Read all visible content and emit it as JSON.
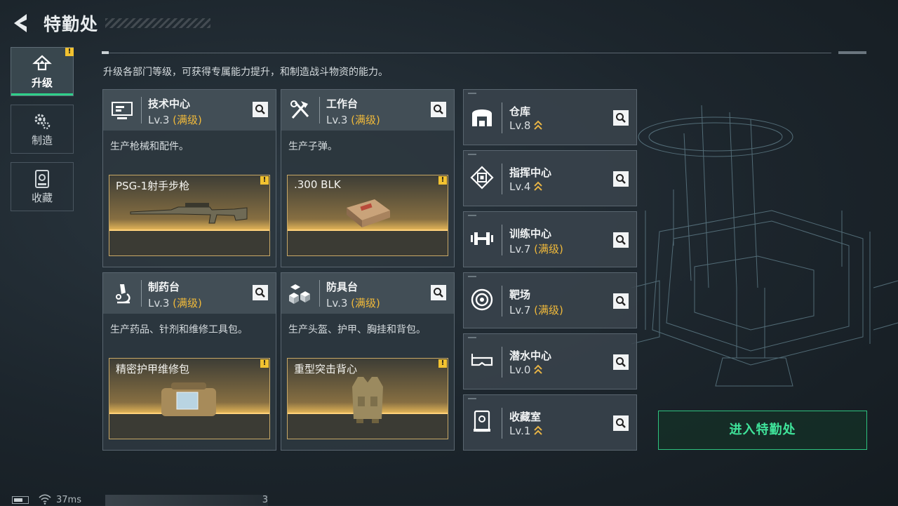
{
  "header": {
    "title": "特勤处"
  },
  "nav": [
    {
      "label": "升级",
      "active": true,
      "icon": "upgrade-icon"
    },
    {
      "label": "制造",
      "active": false,
      "icon": "gear-icon"
    },
    {
      "label": "收藏",
      "active": false,
      "icon": "collection-icon"
    }
  ],
  "description": "升级各部门等级，可获得专属能力提升，和制造战斗物资的能力。",
  "stations": [
    {
      "name": "技术中心",
      "level": "Lv.3",
      "max_label": "(满级)",
      "desc": "生产枪械和配件。",
      "product": "PSG-1射手步枪",
      "icon": "monitor-icon"
    },
    {
      "name": "工作台",
      "level": "Lv.3",
      "max_label": "(满级)",
      "desc": "生产子弹。",
      "product": ".300 BLK",
      "icon": "tools-icon"
    },
    {
      "name": "制药台",
      "level": "Lv.3",
      "max_label": "(满级)",
      "desc": "生产药品、针剂和维修工具包。",
      "product": "精密护甲维修包",
      "icon": "microscope-icon"
    },
    {
      "name": "防具台",
      "level": "Lv.3",
      "max_label": "(满级)",
      "desc": "生产头盔、护甲、胸挂和背包。",
      "product": "重型突击背心",
      "icon": "cubes-icon"
    }
  ],
  "facilities": [
    {
      "name": "仓库",
      "level": "Lv.8",
      "max_label": "",
      "icon": "warehouse-icon"
    },
    {
      "name": "指挥中心",
      "level": "Lv.4",
      "max_label": "",
      "icon": "chip-icon"
    },
    {
      "name": "训练中心",
      "level": "Lv.7",
      "max_label": "(满级)",
      "icon": "dumbbell-icon"
    },
    {
      "name": "靶场",
      "level": "Lv.7",
      "max_label": "(满级)",
      "icon": "target-icon"
    },
    {
      "name": "潜水中心",
      "level": "Lv.0",
      "max_label": "",
      "icon": "diving-mask-icon"
    },
    {
      "name": "收藏室",
      "level": "Lv.1",
      "max_label": "",
      "icon": "showcase-icon"
    }
  ],
  "enter_button": "进入特勤处",
  "footer": {
    "ping": "37ms",
    "uid_suffix": "3"
  },
  "colors": {
    "accent": "#2fd08a",
    "max_level": "#f0b93a",
    "warning": "#f2c230"
  }
}
